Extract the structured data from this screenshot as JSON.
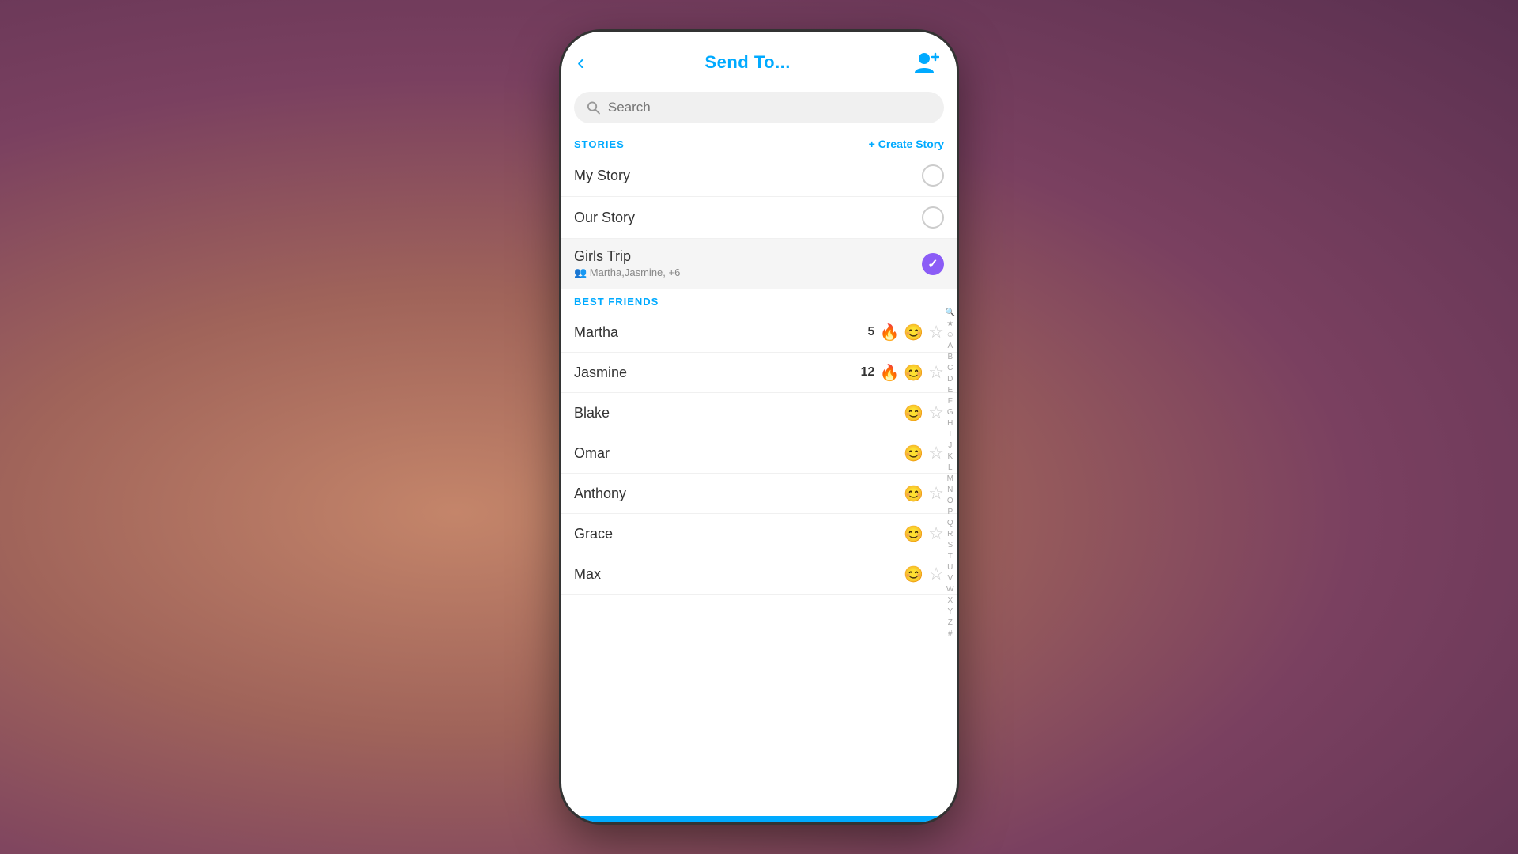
{
  "background": {
    "color": "#8B4A6B"
  },
  "header": {
    "back_label": "‹",
    "title": "Send To...",
    "add_friend_label": "👤+"
  },
  "search": {
    "placeholder": "Search"
  },
  "stories_section": {
    "label": "STORIES",
    "create_button": "+ Create Story",
    "items": [
      {
        "name": "My Story",
        "selected": false
      },
      {
        "name": "Our Story",
        "selected": false
      },
      {
        "name": "Girls Trip",
        "subtitle": "👥 Martha,Jasmine, +6",
        "selected": true
      }
    ]
  },
  "best_friends_section": {
    "label": "BEST FRIENDS",
    "items": [
      {
        "name": "Martha",
        "streak": "5",
        "streak_emoji": "🔥",
        "friend_emoji": "😊",
        "starred": false
      },
      {
        "name": "Jasmine",
        "streak": "12",
        "streak_emoji": "🔥",
        "friend_emoji": "😊",
        "starred": false
      },
      {
        "name": "Blake",
        "streak": "",
        "streak_emoji": "",
        "friend_emoji": "😊",
        "starred": false
      },
      {
        "name": "Omar",
        "streak": "",
        "streak_emoji": "",
        "friend_emoji": "😊",
        "starred": false
      },
      {
        "name": "Anthony",
        "streak": "",
        "streak_emoji": "",
        "friend_emoji": "😊",
        "starred": false
      },
      {
        "name": "Grace",
        "streak": "",
        "streak_emoji": "",
        "friend_emoji": "😊",
        "starred": false
      },
      {
        "name": "Max",
        "streak": "",
        "streak_emoji": "",
        "friend_emoji": "😊",
        "starred": false
      }
    ]
  },
  "alpha_index": [
    "🔍",
    "★",
    "☺",
    "A",
    "B",
    "C",
    "D",
    "E",
    "F",
    "G",
    "H",
    "I",
    "J",
    "K",
    "L",
    "M",
    "N",
    "O",
    "P",
    "Q",
    "R",
    "S",
    "T",
    "U",
    "V",
    "W",
    "X",
    "Y",
    "Z",
    "#"
  ]
}
